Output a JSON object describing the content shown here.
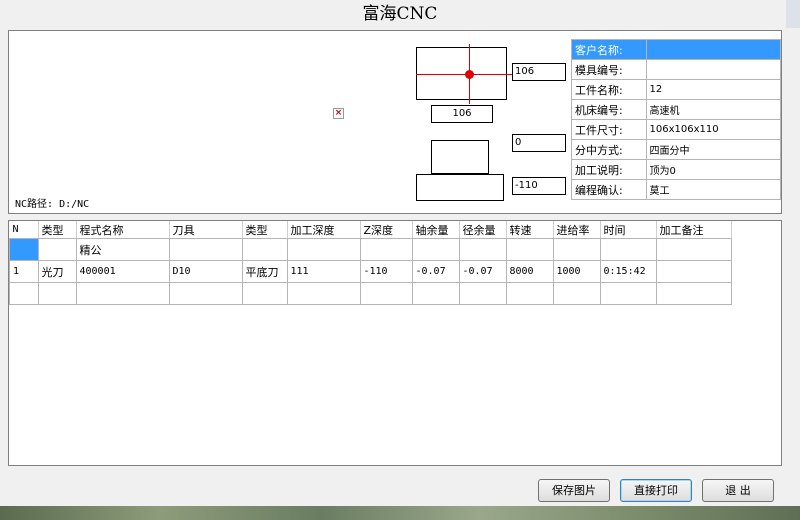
{
  "window": {
    "title": "富海CNC"
  },
  "preview": {
    "nc_path": "NC路径: D:/NC",
    "top_width_value": "106",
    "top_height_value": "106",
    "mid_value": "0",
    "bottom_value": "-110"
  },
  "info": {
    "rows": [
      {
        "label": "客户名称:",
        "value": ""
      },
      {
        "label": "模具编号:",
        "value": ""
      },
      {
        "label": "工件名称:",
        "value": "12"
      },
      {
        "label": "机床编号:",
        "value": "高速机"
      },
      {
        "label": "工件尺寸:",
        "value": "106x106x110"
      },
      {
        "label": "分中方式:",
        "value": "四面分中"
      },
      {
        "label": "加工说明:",
        "value": "顶为0"
      },
      {
        "label": "编程确认:",
        "value": "莫工"
      }
    ]
  },
  "grid": {
    "headers": [
      "N",
      "类型",
      "程式名称",
      "刀具",
      "类型",
      "加工深度",
      "Z深度",
      "轴余量",
      "径余量",
      "转速",
      "进给率",
      "时间",
      "加工备注"
    ],
    "rows": [
      [
        "",
        "",
        "精公",
        "",
        "",
        "",
        "",
        "",
        "",
        "",
        "",
        "",
        ""
      ],
      [
        "1",
        "光刀",
        "400001",
        "D10",
        "平底刀",
        "111",
        "-110",
        "-0.07",
        "-0.07",
        "8000",
        "1000",
        "0:15:42",
        ""
      ],
      [
        "",
        "",
        "",
        "",
        "",
        "",
        "",
        "",
        "",
        "",
        "",
        "",
        ""
      ]
    ]
  },
  "buttons": {
    "save_image": "保存图片",
    "print_direct": "直接打印",
    "exit": "退  出"
  },
  "colors": {
    "selection": "#3399ff",
    "crosshair": "#e00000"
  }
}
